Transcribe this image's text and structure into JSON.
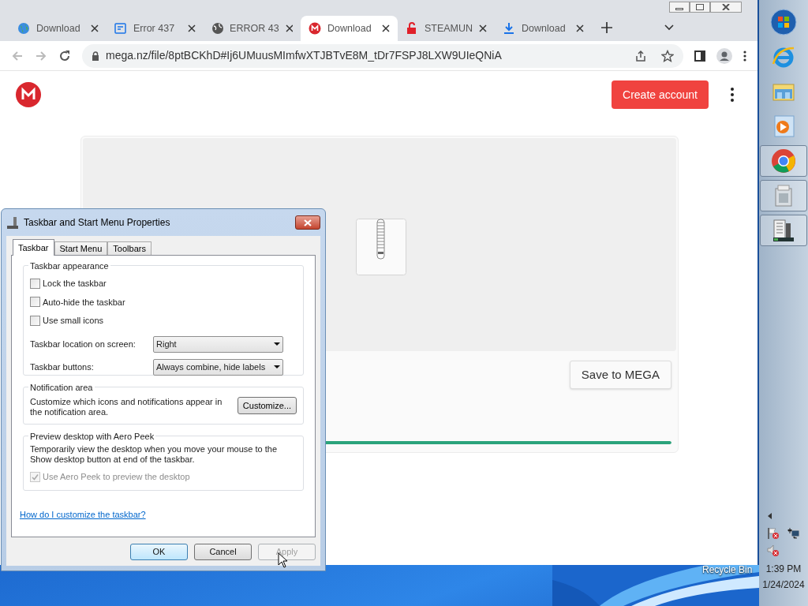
{
  "browser": {
    "tabs": [
      {
        "title": "Download",
        "selected": false
      },
      {
        "title": "Error 437",
        "selected": false
      },
      {
        "title": "ERROR 43",
        "selected": false
      },
      {
        "title": "Download",
        "selected": true
      },
      {
        "title": "STEAMUN",
        "selected": false
      },
      {
        "title": "Download",
        "selected": false
      }
    ],
    "url": "mega.nz/file/8ptBCKhD#Ij6UMuusMImfwXTJBTvE8M_tDr7FSPJ8LXW9UIeQNiA"
  },
  "page": {
    "create_account": "Create account",
    "save_button": "Save to MEGA",
    "progress": {
      "level": 1
    }
  },
  "dialog": {
    "title": "Taskbar and Start Menu Properties",
    "tabs": [
      {
        "label": "Taskbar",
        "selected": true
      },
      {
        "label": "Start Menu",
        "selected": false
      },
      {
        "label": "Toolbars",
        "selected": false
      }
    ],
    "appearance": {
      "heading": "Taskbar appearance",
      "checkboxes": [
        {
          "label": "Lock the taskbar",
          "checked": false
        },
        {
          "label": "Auto-hide the taskbar",
          "checked": false
        },
        {
          "label": "Use small icons",
          "checked": false
        }
      ],
      "selects": [
        {
          "label": "Taskbar location on screen:",
          "value": "Right"
        },
        {
          "label": "Taskbar buttons:",
          "value": "Always combine, hide labels"
        }
      ]
    },
    "notification": {
      "heading": "Notification area",
      "text": "Customize which icons and notifications appear in the notification area.",
      "button": "Customize..."
    },
    "peek": {
      "heading": "Preview desktop with Aero Peek",
      "text": "Temporarily view the desktop when you move your mouse to the Show desktop button at end of the taskbar.",
      "checkbox": {
        "label": "Use Aero Peek to preview the desktop",
        "checked": true,
        "disabled": true
      }
    },
    "link": "How do I customize the taskbar?",
    "buttons": [
      {
        "label": "OK",
        "kind": "default",
        "disabled": false
      },
      {
        "label": "Cancel",
        "kind": "normal",
        "disabled": false
      },
      {
        "label": "Apply",
        "kind": "normal",
        "disabled": true
      }
    ]
  },
  "desktop": {
    "recycle_bin": "Recycle Bin"
  },
  "taskbar": {
    "items": [
      {
        "running": false
      },
      {
        "running": false
      },
      {
        "running": false
      },
      {
        "running": false
      },
      {
        "running": true
      },
      {
        "running": true
      },
      {
        "running": true
      }
    ],
    "time": "1:39 PM",
    "date": "1/24/2024"
  }
}
